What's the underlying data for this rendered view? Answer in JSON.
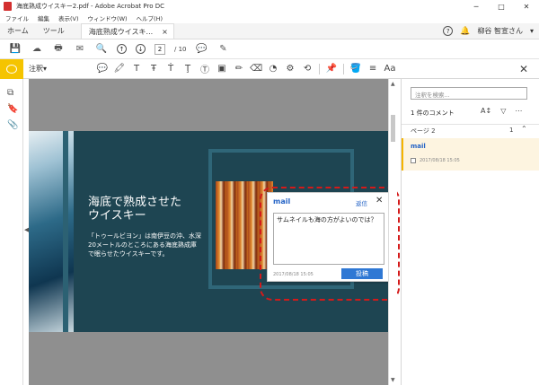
{
  "window": {
    "title": "海底熟成ウイスキー2.pdf - Adobe Acrobat Pro DC",
    "controls": [
      "─",
      "□",
      "✕"
    ]
  },
  "menu": [
    "ファイル",
    "編集",
    "表示(V)",
    "ウィンドウ(W)",
    "ヘルプ(H)"
  ],
  "tabs": {
    "home": "ホーム",
    "tools": "ツール",
    "document": "海底熟成ウイスキ...",
    "document_close": "×"
  },
  "user": {
    "name": "柳谷 智宣さん",
    "dropdown": "▾"
  },
  "toolbar": {
    "page_current": "2",
    "page_total": "/ 10"
  },
  "comment_toolbar": {
    "label": "注釈",
    "dropdown": "▾",
    "text_tool": "Aa"
  },
  "slide": {
    "title_line1": "海底で熟成させた",
    "title_line2": "ウイスキー",
    "body_line1": "「トゥールビヨン」は南伊豆の沖、水深",
    "body_line2": "20メートルのところにある海底熟成庫",
    "body_line3": "で眠らせたウイスキーです。"
  },
  "popup": {
    "author": "mail",
    "reply_label": "返信",
    "close": "✕",
    "text": "サムネイルも海の方がよいのでは？",
    "date": "2017/08/18  15:05",
    "post_label": "投稿"
  },
  "panel": {
    "search_placeholder": "注釈を検索...",
    "count_label": "1 件のコメント",
    "page_label": "ページ 2",
    "page_count": "1",
    "card_author": "mail",
    "card_date": "2017/08/18  15:05"
  },
  "colors": {
    "accent_yellow": "#f5c400",
    "link_blue": "#2463c6",
    "post_button": "#2f78d4",
    "highlight_ring": "#d41a1a",
    "slide_bg": "#1e4552"
  }
}
